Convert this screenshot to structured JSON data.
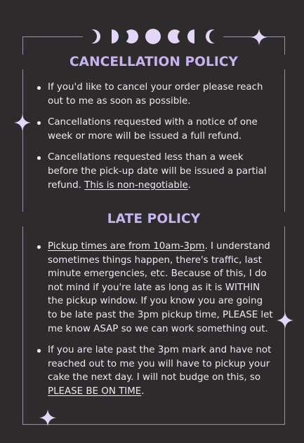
{
  "cancellation": {
    "heading": "CANCELLATION POLICY",
    "items": [
      {
        "text": "If you'd like to cancel your order please reach out to me as soon as possible."
      },
      {
        "text": "Cancellations requested with a notice of one week or more will be issued a full refund."
      },
      {
        "text": "Cancellations requested less than a week before the pick-up date will be issued a partial refund. ",
        "underlined": "This is non-negotiable",
        "after": "."
      }
    ]
  },
  "late": {
    "heading": "LATE POLICY",
    "items": [
      {
        "underlined": "Pickup times are from 10am-3pm",
        "text": ". I understand sometimes things happen, there's traffic, last minute emergencies, etc. Because of this, I do not mind if you're late as long as it is WITHIN the pickup window. If you know you are going to be late past the 3pm pickup time, PLEASE let me know ASAP so we can work something out."
      },
      {
        "text": "If you are late past the 3pm mark and have not reached out to me you will have to pickup your cake the next day. I will not budge on this, so ",
        "underlined": "PLEASE BE ON TIME",
        "after": "."
      }
    ]
  },
  "decor": {
    "moon_phase_icons": [
      "waxing-crescent",
      "first-quarter",
      "waxing-gibbous",
      "full-moon",
      "waning-gibbous",
      "last-quarter",
      "waning-crescent"
    ],
    "sparkle_icons": 4
  },
  "colors": {
    "background": "#2e2b2d",
    "heading": "#c8b3f2",
    "text": "#efe8f4",
    "frame": "#9a93a8"
  }
}
